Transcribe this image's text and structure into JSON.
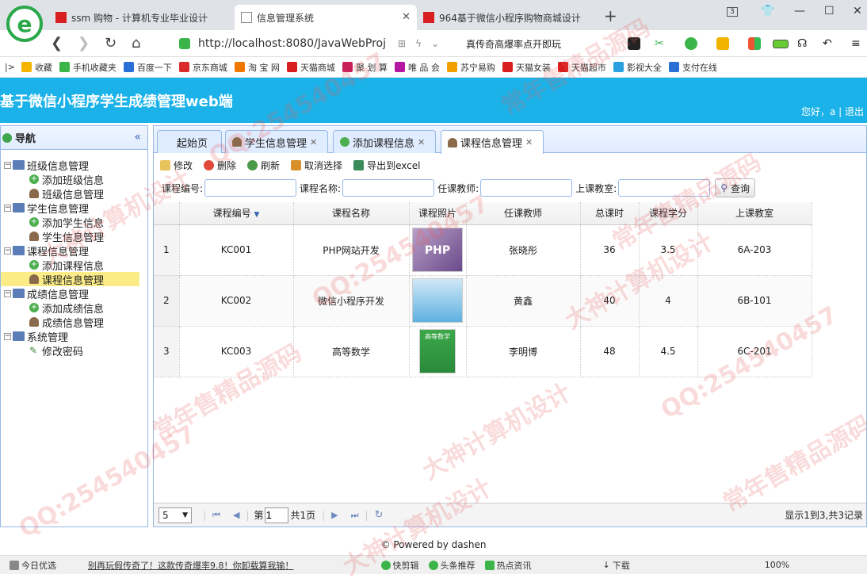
{
  "browser": {
    "tabs": [
      {
        "label": "ssm 购物 - 计算机专业毕业设计"
      },
      {
        "label": "信息管理系统"
      },
      {
        "label": "964基于微信小程序购物商城设计"
      }
    ],
    "tab_counter": "3",
    "url": "http://localhost:8080/JavaWebProj",
    "slogan": "真传奇高爆率点开即玩",
    "bookmarks": [
      "收藏",
      "手机收藏夹",
      "百度一下",
      "京东商城",
      "淘 宝 网",
      "天猫商城",
      "聚 划 算",
      "唯 品 会",
      "苏宁易购",
      "天猫女装",
      "天猫超市",
      "影视大全",
      "支付在线"
    ],
    "bookmark_colors": [
      "#f5b400",
      "#3bb54a",
      "#2a6fd6",
      "#d92b2b",
      "#f07800",
      "#d81e1e",
      "#c81e5a",
      "#b5179e",
      "#f0a000",
      "#d81e1e",
      "#d81e1e",
      "#2aa0e0",
      "#2a6fd6"
    ]
  },
  "app": {
    "title": "基于微信小程序学生成绩管理web端",
    "user": "您好，a | 退出"
  },
  "sidebar": {
    "title": "导航",
    "groups": [
      {
        "label": "班级信息管理",
        "children": [
          "添加班级信息",
          "班级信息管理"
        ]
      },
      {
        "label": "学生信息管理",
        "children": [
          "添加学生信息",
          "学生信息管理"
        ]
      },
      {
        "label": "课程信息管理",
        "children": [
          "添加课程信息",
          "课程信息管理"
        ]
      },
      {
        "label": "成绩信息管理",
        "children": [
          "添加成绩信息",
          "成绩信息管理"
        ]
      },
      {
        "label": "系统管理",
        "children": [
          "修改密码"
        ]
      }
    ]
  },
  "content_tabs": [
    "起始页",
    "学生信息管理",
    "添加课程信息",
    "课程信息管理"
  ],
  "toolbar": {
    "edit": "修改",
    "delete": "删除",
    "refresh": "刷新",
    "cancel": "取消选择",
    "export": "导出到excel"
  },
  "search": {
    "code": "课程编号:",
    "name": "课程名称:",
    "teacher": "任课教师:",
    "room": "上课教室:",
    "button": "查询"
  },
  "table": {
    "headers": [
      "课程编号",
      "课程名称",
      "课程照片",
      "任课教师",
      "总课时",
      "课程学分",
      "上课教室"
    ],
    "rows": [
      {
        "n": "1",
        "code": "KC001",
        "name": "PHP网站开发",
        "teacher": "张晓彤",
        "hours": "36",
        "credit": "3.5",
        "room": "6A-203",
        "img": "PHP"
      },
      {
        "n": "2",
        "code": "KC002",
        "name": "微信小程序开发",
        "teacher": "黄鑫",
        "hours": "40",
        "credit": "4",
        "room": "6B-101",
        "img": ""
      },
      {
        "n": "3",
        "code": "KC003",
        "name": "高等数学",
        "teacher": "李明博",
        "hours": "48",
        "credit": "4.5",
        "room": "6C-201",
        "img": "高等数学"
      }
    ]
  },
  "pager": {
    "size": "5",
    "page_prefix": "第",
    "page": "1",
    "page_suffix": "共1页",
    "info": "显示1到3,共3记录"
  },
  "footer": "© Powered by dashen",
  "statusbar": [
    "今日优选",
    "别再玩假传奇了！这款传奇爆率9.8！你卸载算我输！",
    "快剪辑",
    "头条推荐",
    "热点资讯",
    "下载",
    "100%"
  ],
  "watermarks": [
    "QQ:254540457",
    "常年售精品源码",
    "大神计算机设计"
  ]
}
